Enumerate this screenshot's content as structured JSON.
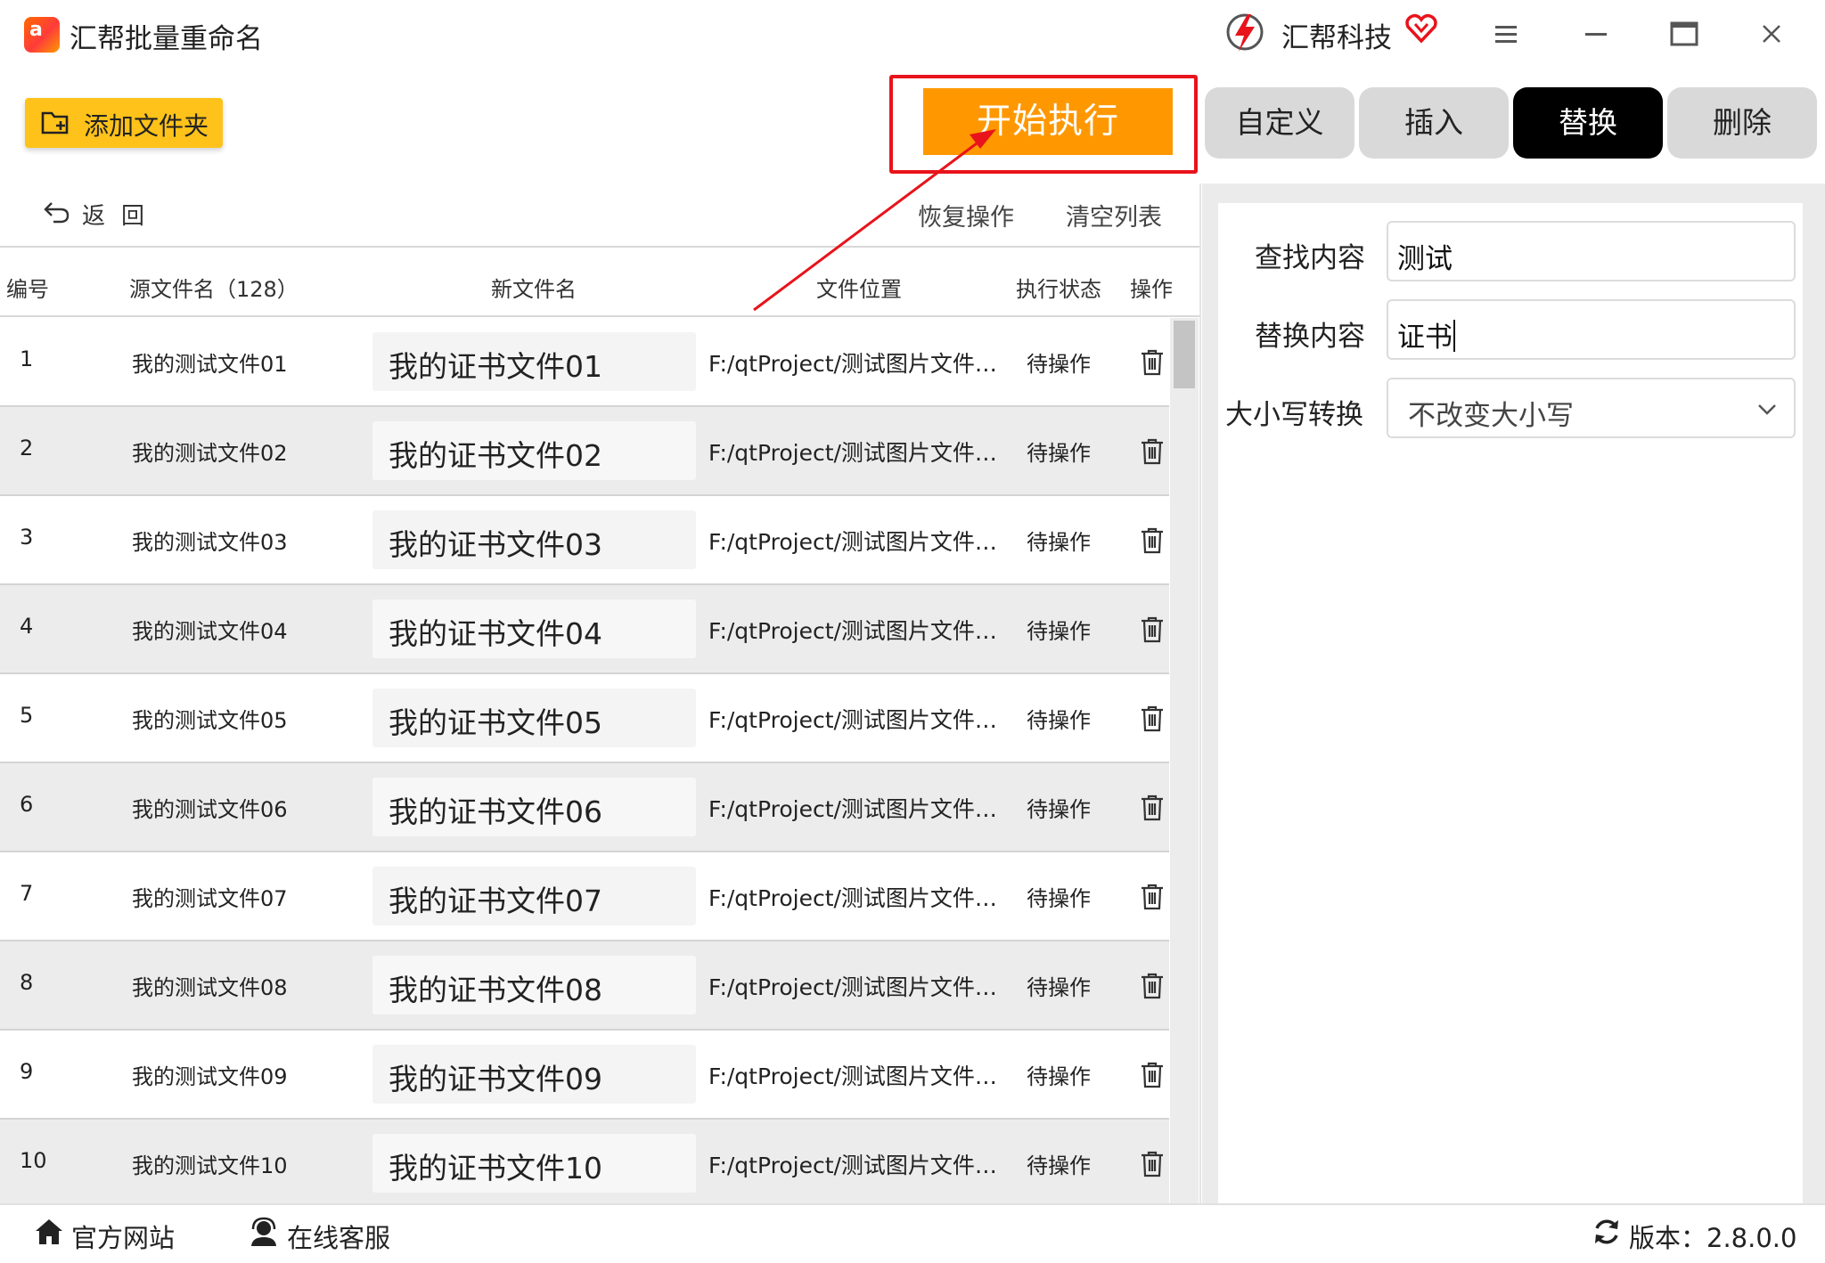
{
  "window": {
    "title": "汇帮批量重命名",
    "brand": "汇帮科技"
  },
  "toolbar": {
    "add_folder": "添加文件夹",
    "start": "开始执行",
    "back": "返回",
    "restore": "恢复操作",
    "clear": "清空列表"
  },
  "tabs": [
    {
      "label": "自定义",
      "active": false
    },
    {
      "label": "插入",
      "active": false
    },
    {
      "label": "替换",
      "active": true
    },
    {
      "label": "删除",
      "active": false
    }
  ],
  "table": {
    "headers": {
      "no": "编号",
      "source": "源文件名（128）",
      "new_name": "新文件名",
      "location": "文件位置",
      "status": "执行状态",
      "op": "操作"
    },
    "rows": [
      {
        "no": "1",
        "source": "我的测试文件01",
        "new_name": "我的证书文件01",
        "location": "F:/qtProject/测试图片文件夹/...",
        "status": "待操作"
      },
      {
        "no": "2",
        "source": "我的测试文件02",
        "new_name": "我的证书文件02",
        "location": "F:/qtProject/测试图片文件夹/...",
        "status": "待操作"
      },
      {
        "no": "3",
        "source": "我的测试文件03",
        "new_name": "我的证书文件03",
        "location": "F:/qtProject/测试图片文件夹/...",
        "status": "待操作"
      },
      {
        "no": "4",
        "source": "我的测试文件04",
        "new_name": "我的证书文件04",
        "location": "F:/qtProject/测试图片文件夹/...",
        "status": "待操作"
      },
      {
        "no": "5",
        "source": "我的测试文件05",
        "new_name": "我的证书文件05",
        "location": "F:/qtProject/测试图片文件夹/...",
        "status": "待操作"
      },
      {
        "no": "6",
        "source": "我的测试文件06",
        "new_name": "我的证书文件06",
        "location": "F:/qtProject/测试图片文件夹/...",
        "status": "待操作"
      },
      {
        "no": "7",
        "source": "我的测试文件07",
        "new_name": "我的证书文件07",
        "location": "F:/qtProject/测试图片文件夹/...",
        "status": "待操作"
      },
      {
        "no": "8",
        "source": "我的测试文件08",
        "new_name": "我的证书文件08",
        "location": "F:/qtProject/测试图片文件夹/...",
        "status": "待操作"
      },
      {
        "no": "9",
        "source": "我的测试文件09",
        "new_name": "我的证书文件09",
        "location": "F:/qtProject/测试图片文件夹/...",
        "status": "待操作"
      },
      {
        "no": "10",
        "source": "我的测试文件10",
        "new_name": "我的证书文件10",
        "location": "F:/qtProject/测试图片文件夹/...",
        "status": "待操作"
      }
    ]
  },
  "form": {
    "find_label": "查找内容",
    "find_value": "测试",
    "replace_label": "替换内容",
    "replace_value": "证书",
    "case_label": "大小写转换",
    "case_value": "不改变大小写"
  },
  "footer": {
    "website": "官方网站",
    "support": "在线客服",
    "version": "版本：2.8.0.0"
  },
  "colors": {
    "start_button": "#ff9800",
    "add_folder_button": "#ffc21a",
    "highlight_box": "#e8131b",
    "active_tab": "#000000"
  }
}
